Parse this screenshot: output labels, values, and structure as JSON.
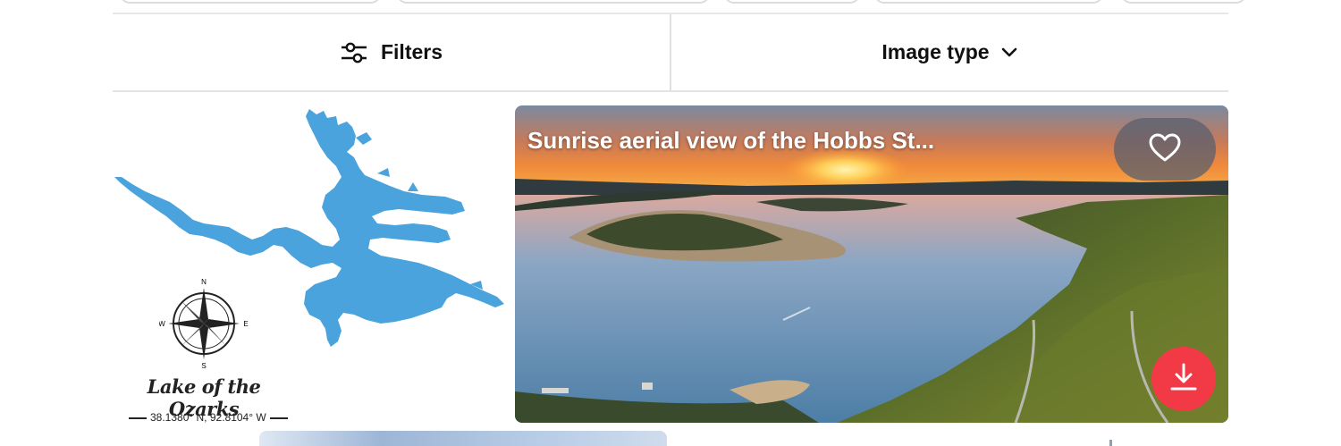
{
  "toolbar": {
    "filters_label": "Filters",
    "filters_icon": "sliders-icon",
    "image_type_label": "Image type",
    "image_type_icon": "chevron-down-icon"
  },
  "results": [
    {
      "type": "vector",
      "lake_name": "Lake of the Ozarks",
      "coordinates": "38.1380° N, 92.8104° W",
      "compass_letters": {
        "n": "N",
        "e": "E",
        "s": "S",
        "w": "W"
      },
      "lake_color": "#4aa3dd"
    },
    {
      "type": "photo",
      "title": "Sunrise aerial view of the Hobbs St...",
      "favorite_icon": "heart-icon",
      "download_icon": "download-icon",
      "download_color": "#f23a46"
    }
  ]
}
